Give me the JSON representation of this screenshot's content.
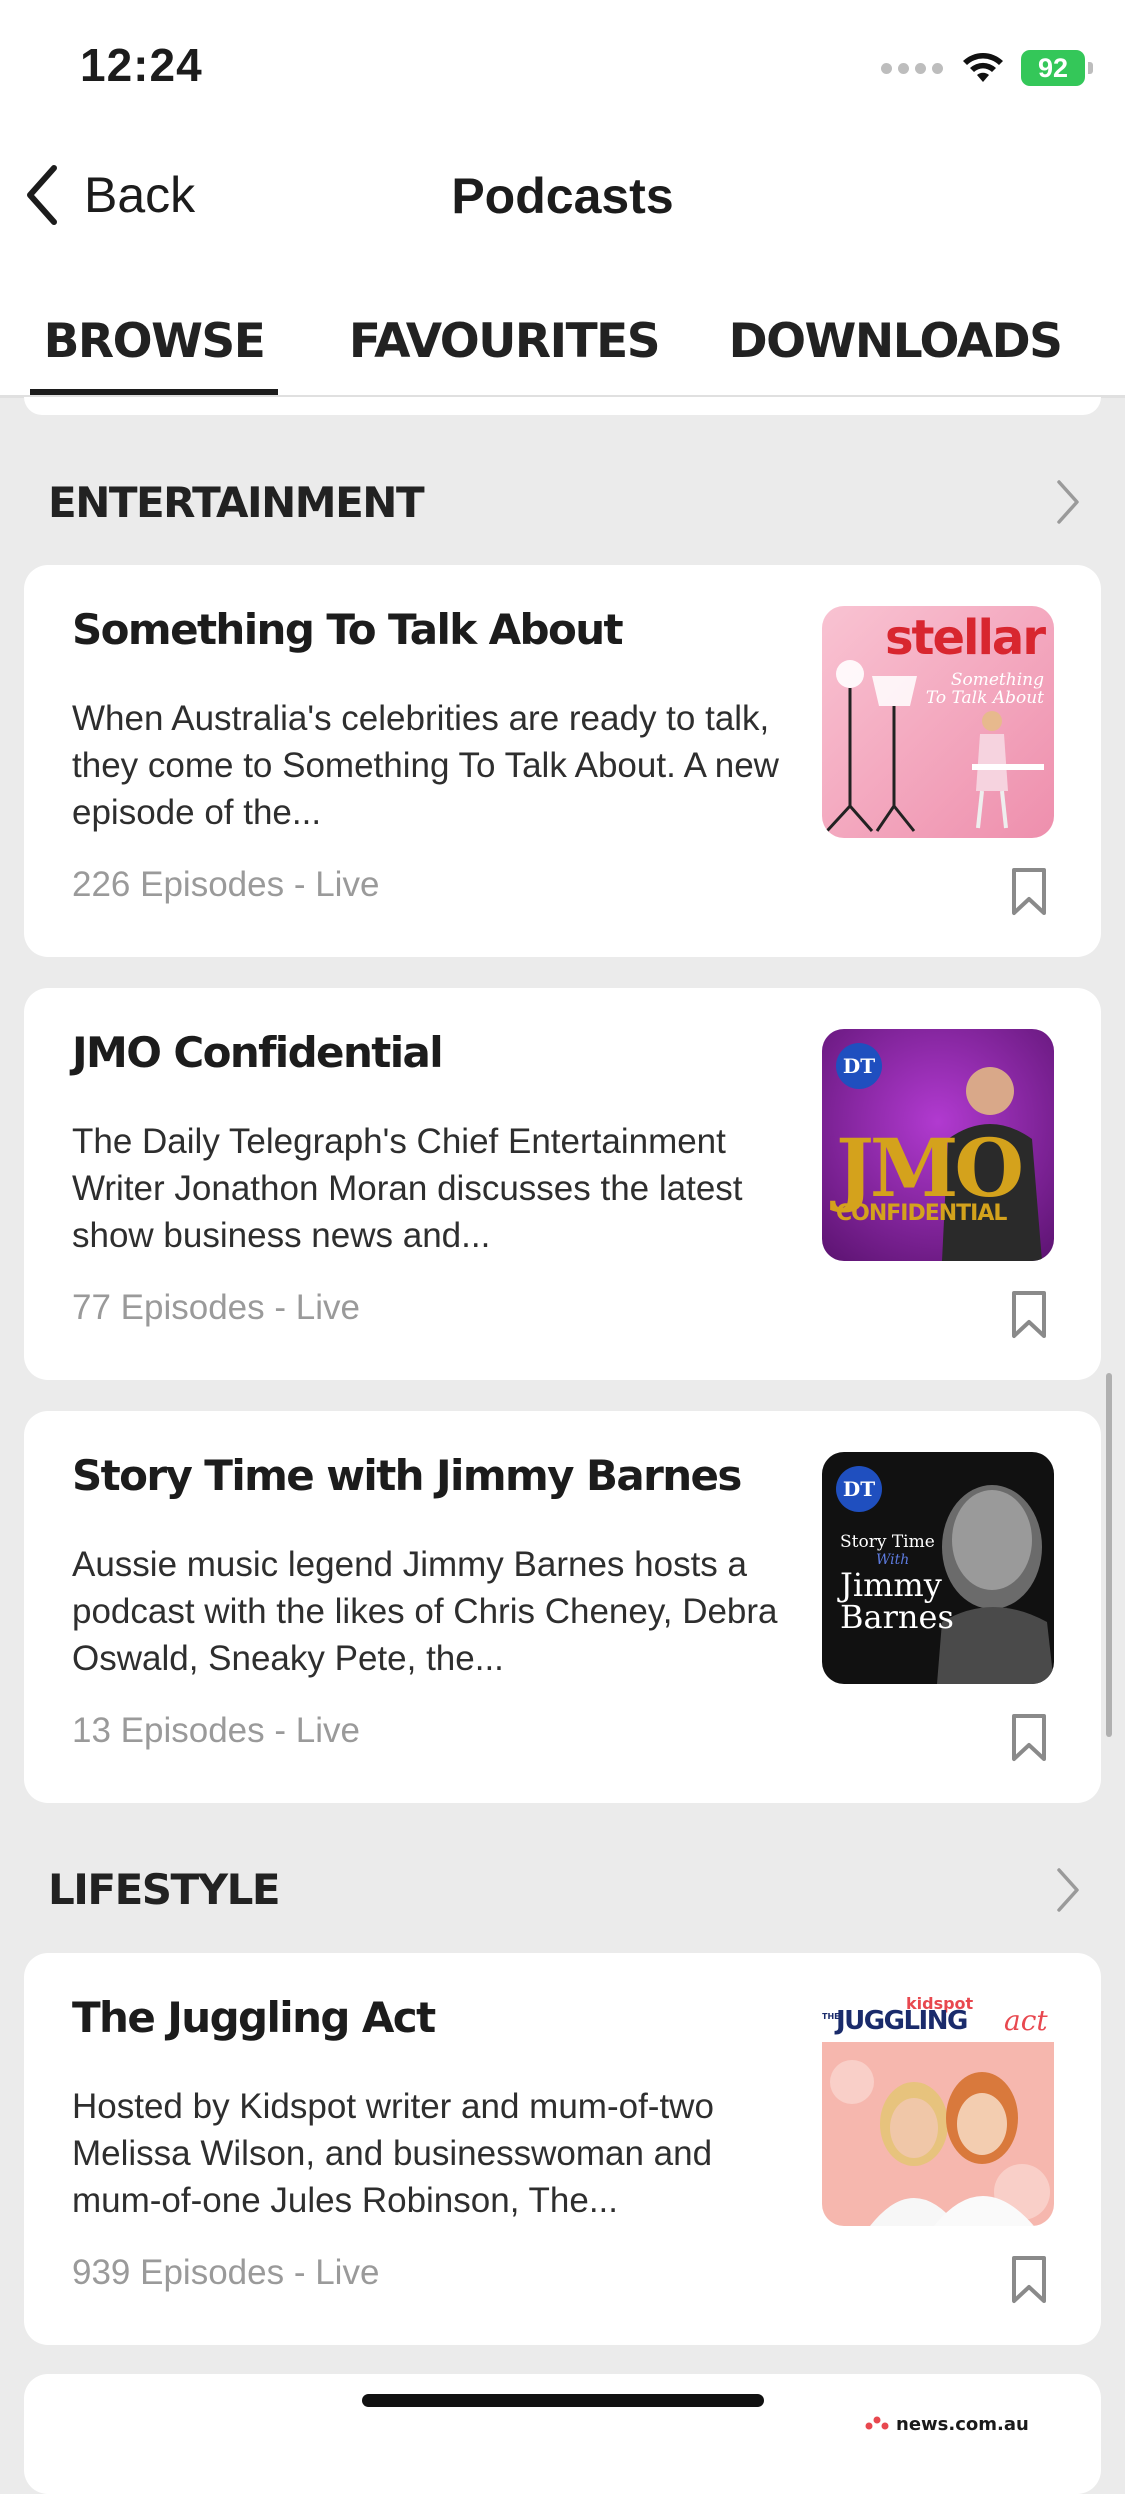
{
  "status_bar": {
    "time": "12:24",
    "battery": "92"
  },
  "nav": {
    "back_label": "Back",
    "title": "Podcasts"
  },
  "tabs": [
    {
      "label": "BROWSE",
      "active": true
    },
    {
      "label": "FAVOURITES",
      "active": false
    },
    {
      "label": "DOWNLOADS",
      "active": false
    }
  ],
  "sections": [
    {
      "title": "ENTERTAINMENT",
      "items": [
        {
          "title": "Something To Talk About",
          "description": "When Australia's celebrities are ready to talk, they come to Something To Talk About. A new episode of the...",
          "meta": "226 Episodes - Live",
          "art": {
            "brand": "stellar",
            "subtitle_1": "Something",
            "subtitle_2": "To Talk About",
            "bg": "#f4a9bf",
            "accent": "#d8262f"
          }
        },
        {
          "title": "JMO Confidential",
          "description": "The Daily Telegraph's Chief Entertainment Writer Jonathon Moran discusses the latest show business news and...",
          "meta": "77 Episodes - Live",
          "art": {
            "badge": "DT",
            "logo": "JMO",
            "logo_sub": "CONFIDENTIAL",
            "bg": "#7a1f8c",
            "accent": "#d4a21c"
          }
        },
        {
          "title": "Story Time with Jimmy Barnes",
          "description": "Aussie music legend Jimmy Barnes hosts a podcast with the likes of Chris Cheney, Debra Oswald, Sneaky Pete, the...",
          "meta": "13 Episodes - Live",
          "art": {
            "badge": "DT",
            "line_1": "Story Time",
            "line_2": "With",
            "line_3": "Jimmy",
            "line_4": "Barnes",
            "bg": "#111111"
          }
        }
      ]
    },
    {
      "title": "LIFESTYLE",
      "items": [
        {
          "title": "The Juggling Act",
          "description": "Hosted by Kidspot writer and mum-of-two Melissa Wilson, and businesswoman and mum-of-one Jules Robinson, The...",
          "meta": "939 Episodes - Live",
          "art": {
            "brand": "kidspot",
            "logo_prefix": "THE",
            "logo": "JUGGLING",
            "logo_suffix": "act",
            "bg": "#f6b7ae",
            "accent": "#e8484f"
          }
        }
      ]
    }
  ],
  "next_card_peek": {
    "brand": "news.com.au"
  }
}
